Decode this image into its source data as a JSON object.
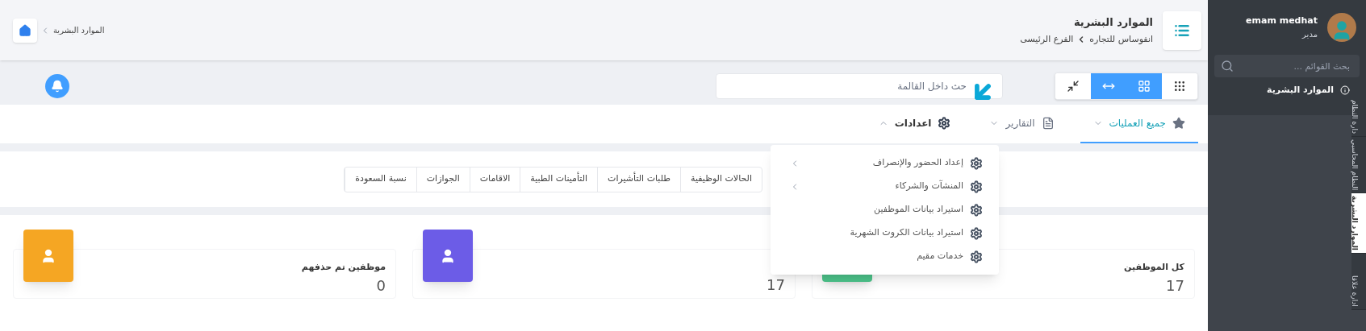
{
  "topbar": {
    "breadcrumb": "الموارد البشرية"
  },
  "header": {
    "title": "الموارد البشرية",
    "breadcrumb": [
      "انفوساس للتجاره",
      "الفرع الرئيسى"
    ]
  },
  "toolbar": {
    "view_buttons": [
      {
        "kind": "dots",
        "selected": false
      },
      {
        "kind": "grid",
        "selected": true
      },
      {
        "kind": "stretch",
        "selected": true
      },
      {
        "kind": "shrink",
        "selected": false
      }
    ],
    "search": {
      "placeholder": "حث داخل القالمة"
    }
  },
  "nav_tabs": [
    {
      "label": "جميع العمليات",
      "kind": "star",
      "selected": true,
      "expanded": false
    },
    {
      "label": "التقارير",
      "kind": "file",
      "selected": false,
      "expanded": false
    },
    {
      "label": "اعدادات",
      "kind": "gear",
      "selected": false,
      "expanded": true
    }
  ],
  "dropdown": {
    "items": [
      {
        "label": "إعداد الحضور والإنصراف",
        "submenu": true
      },
      {
        "label": "المنشآت والشركاء",
        "submenu": true
      },
      {
        "label": "استيراد بيانات الموظفين",
        "submenu": false
      },
      {
        "label": "استيراد بيانات الكروت الشهرية",
        "submenu": false
      },
      {
        "label": "خدمات مقيم",
        "submenu": false
      }
    ]
  },
  "section_tabs": [
    "الحالات الوظيفية",
    "طلبات التأشيرات",
    "التأمينات الطبية",
    "الاقامات",
    "الجوازات",
    "نسبة السعودة"
  ],
  "stat_cards": [
    {
      "label": "كل الموظفين",
      "value": "17",
      "color": "#4cc38a",
      "kind": "covered"
    },
    {
      "value": "17",
      "color": "#6c5ce7",
      "kind": "user"
    },
    {
      "label": "موظفين تم حذفهم",
      "value": "0",
      "color": "#f5a623",
      "kind": "user"
    }
  ],
  "sidebar": {
    "user": {
      "name": "emam medhat",
      "role": "مدير"
    },
    "search": {
      "placeholder": "بحث القوائم ..."
    },
    "menu_items": [
      {
        "label": "الموارد البشرية"
      }
    ],
    "vertical_tabs": [
      {
        "label": "دارة النظام",
        "selected": false
      },
      {
        "label": "النظام المحاسبي",
        "selected": false
      },
      {
        "label": "الموارد البشرية",
        "selected": true
      },
      {
        "label": "ادارة علاقا",
        "selected": false
      }
    ]
  }
}
